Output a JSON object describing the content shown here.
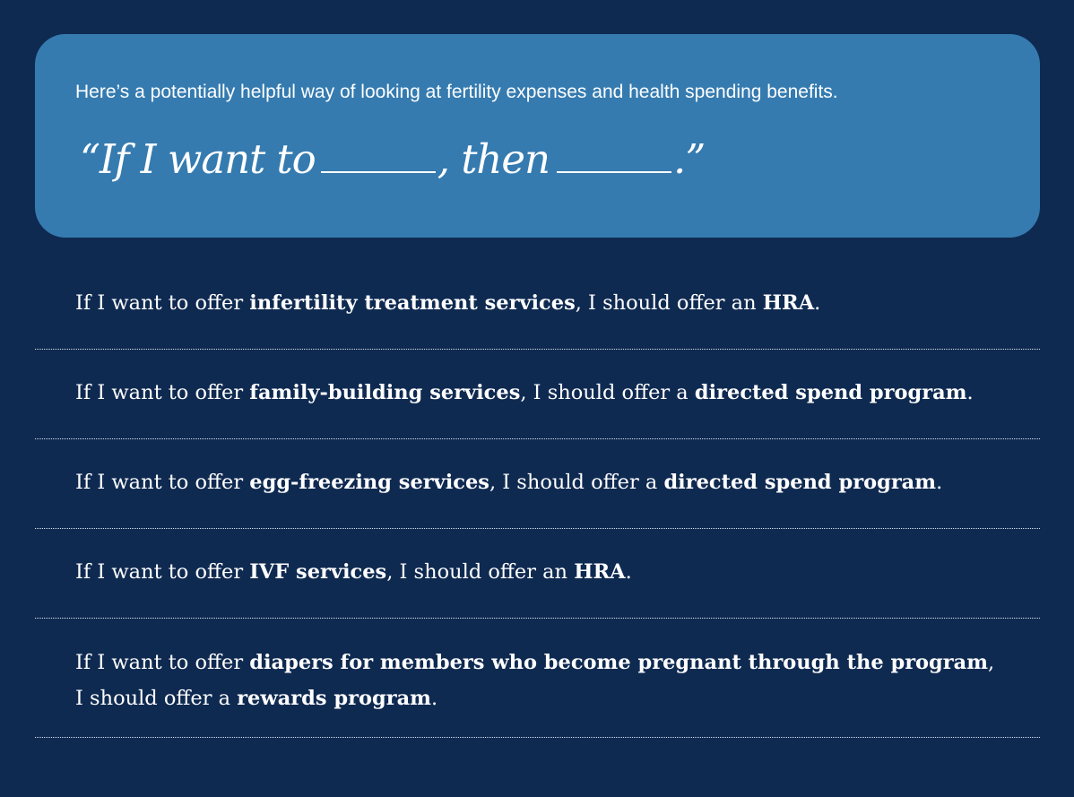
{
  "callout": {
    "intro": "Here’s a potentially helpful way of looking at fertility expenses and health spending benefits.",
    "quote_open": "“If I want to",
    "quote_middle": ", then",
    "quote_close": ".”"
  },
  "rules": [
    {
      "lead": "If I want to offer ",
      "service": "infertility treatment services",
      "middle": ", I should offer an ",
      "benefit": "HRA",
      "end": "."
    },
    {
      "lead": "If I want to offer ",
      "service": "family-building services",
      "middle": ", I should offer a ",
      "benefit": "directed spend program",
      "end": "."
    },
    {
      "lead": "If I want to offer ",
      "service": "egg-freezing services",
      "middle": ", I should offer a ",
      "benefit": "directed spend program",
      "end": "."
    },
    {
      "lead": "If I want to offer ",
      "service": "IVF services",
      "middle": ", I should offer an ",
      "benefit": "HRA",
      "end": "."
    },
    {
      "lead": "If I want to offer ",
      "service": "diapers for members who become pregnant through the program",
      "middle": ", I should offer a ",
      "benefit": "rewards program",
      "end": "."
    }
  ],
  "colors": {
    "page_background": "#0f2a51",
    "callout_background": "#357bb0",
    "text": "#ffffff",
    "divider": "#d8e2ee"
  }
}
